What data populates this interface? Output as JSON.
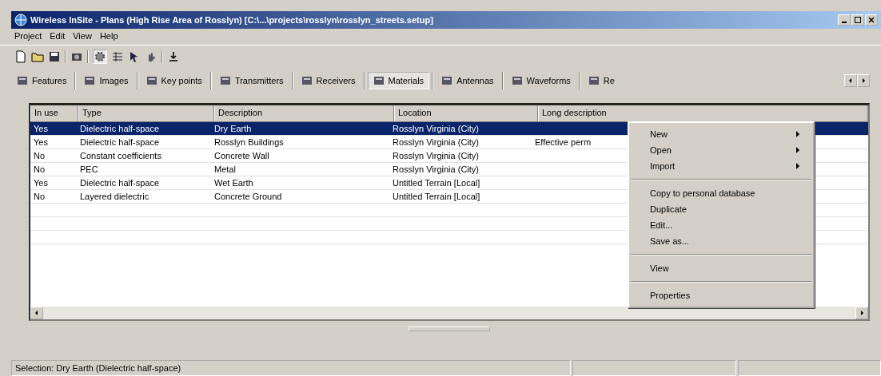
{
  "window": {
    "title": "Wireless InSite - Plans (High Rise Area of Rosslyn) [C:\\...\\projects\\rosslyn\\rosslyn_streets.setup]"
  },
  "menu": [
    "Project",
    "Edit",
    "View",
    "Help"
  ],
  "tabs": [
    {
      "label": "Features",
      "selected": false
    },
    {
      "label": "Images",
      "selected": false
    },
    {
      "label": "Key points",
      "selected": false
    },
    {
      "label": "Transmitters",
      "selected": false
    },
    {
      "label": "Receivers",
      "selected": false
    },
    {
      "label": "Materials",
      "selected": true
    },
    {
      "label": "Antennas",
      "selected": false
    },
    {
      "label": "Waveforms",
      "selected": false
    },
    {
      "label": "Re",
      "selected": false
    }
  ],
  "table": {
    "columns": [
      "In use",
      "Type",
      "Description",
      "Location",
      "Long description"
    ],
    "rows": [
      {
        "cells": [
          "Yes",
          "Dielectric half-space",
          "Dry Earth",
          "Rosslyn Virginia (City)",
          ""
        ],
        "selected": true
      },
      {
        "cells": [
          "Yes",
          "Dielectric half-space",
          "Rosslyn Buildings",
          "Rosslyn Virginia (City)",
          "Effective perm"
        ],
        "selected": false
      },
      {
        "cells": [
          "No",
          "Constant coefficients",
          "Concrete Wall",
          "Rosslyn Virginia (City)",
          ""
        ],
        "selected": false
      },
      {
        "cells": [
          "No",
          "PEC",
          "Metal",
          "Rosslyn Virginia (City)",
          ""
        ],
        "selected": false
      },
      {
        "cells": [
          "Yes",
          "Dielectric half-space",
          "Wet Earth",
          "Untitled Terrain [Local]",
          ""
        ],
        "selected": false
      },
      {
        "cells": [
          "No",
          "Layered dielectric",
          "Concrete Ground",
          "Untitled Terrain [Local]",
          ""
        ],
        "selected": false
      }
    ]
  },
  "context_menu": [
    {
      "kind": "submenu",
      "label": "New"
    },
    {
      "kind": "submenu",
      "label": "Open"
    },
    {
      "kind": "submenu",
      "label": "Import"
    },
    {
      "kind": "separator"
    },
    {
      "kind": "item",
      "label": "Copy to personal database"
    },
    {
      "kind": "item",
      "label": "Duplicate"
    },
    {
      "kind": "item",
      "label": "Edit..."
    },
    {
      "kind": "item",
      "label": "Save as..."
    },
    {
      "kind": "separator"
    },
    {
      "kind": "item",
      "label": "View"
    },
    {
      "kind": "separator"
    },
    {
      "kind": "item",
      "label": "Properties"
    }
  ],
  "status_bar": [
    "Selection: Dry Earth (Dielectric half-space)"
  ]
}
